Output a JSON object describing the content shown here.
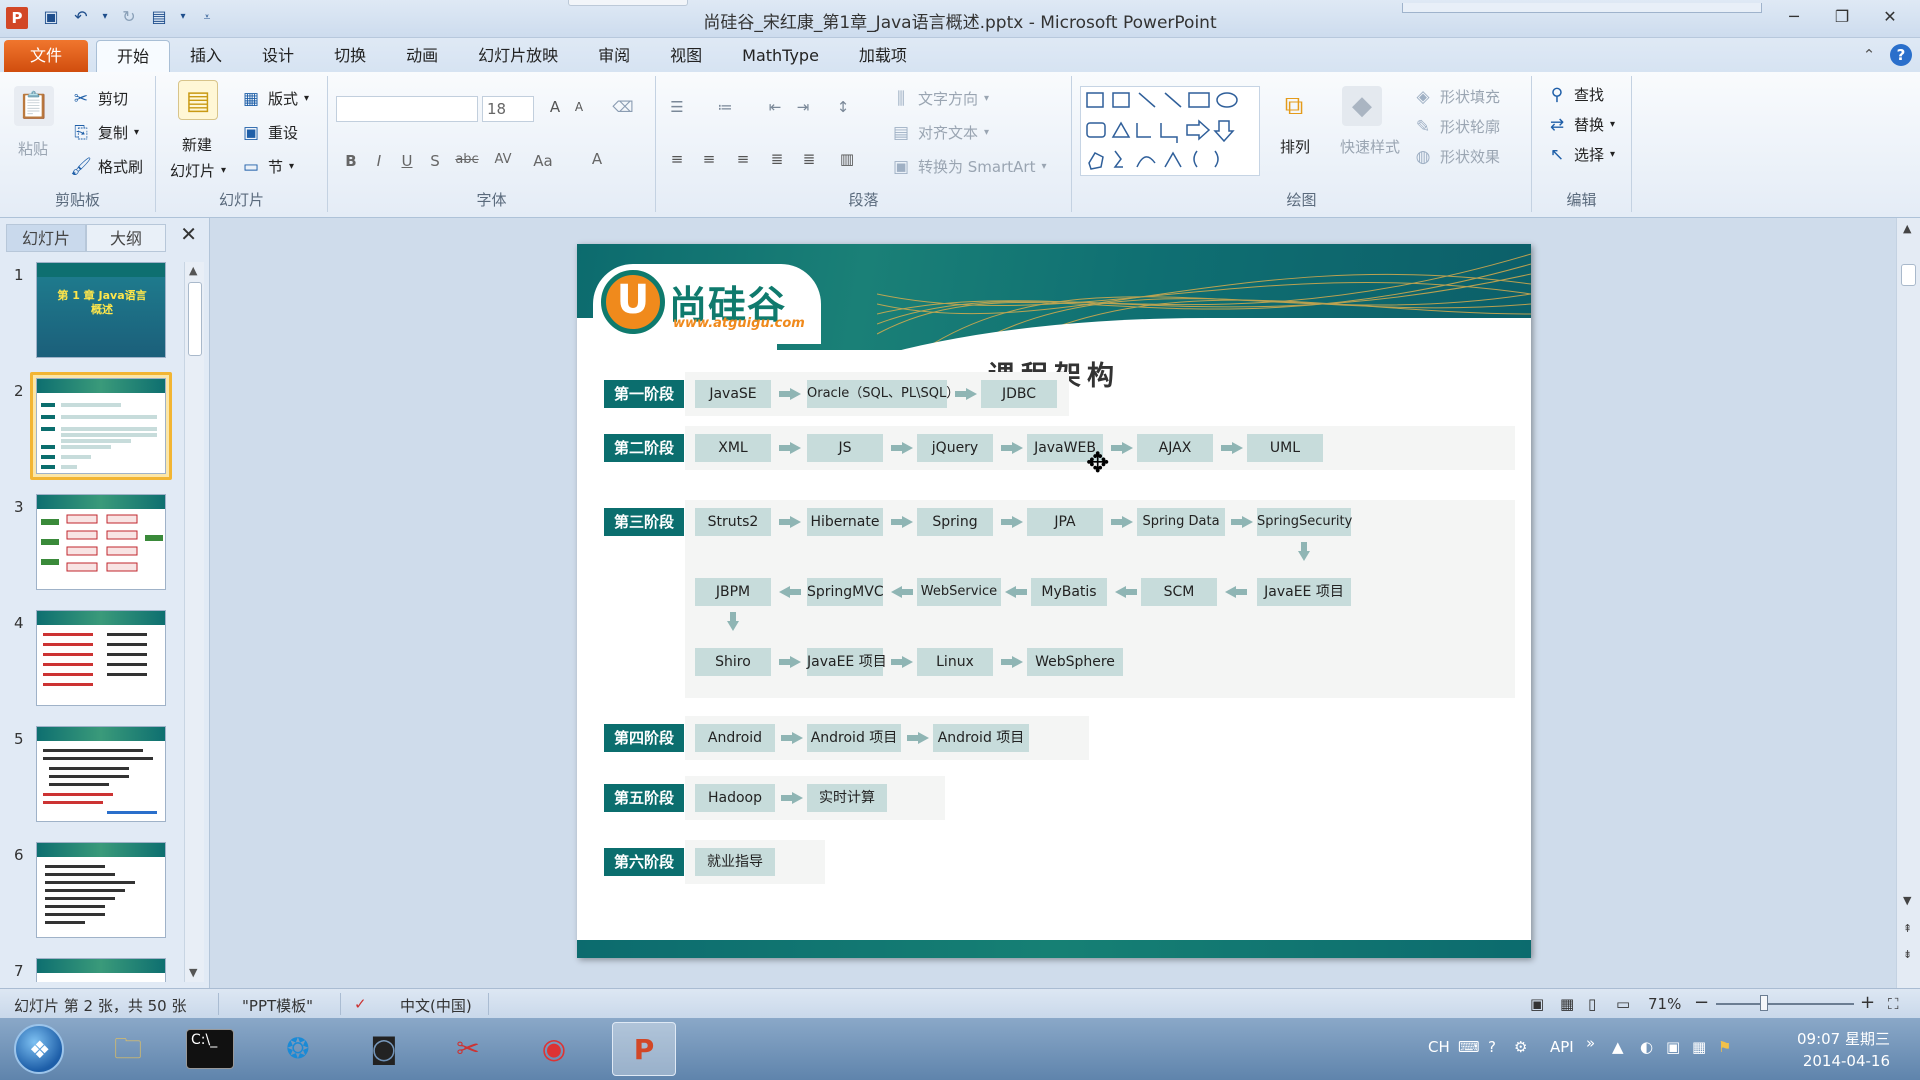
{
  "window": {
    "title": "尚硅谷_宋红康_第1章_Java语言概述.pptx - Microsoft PowerPoint",
    "app_icon_letter": "P",
    "controls": {
      "minimize": "─",
      "restore": "❐",
      "close": "✕"
    }
  },
  "quick_access": [
    "save-icon",
    "undo-icon",
    "redo-icon",
    "present-icon",
    "customize-icon"
  ],
  "tabs": [
    {
      "label": "文件"
    },
    {
      "label": "开始"
    },
    {
      "label": "插入"
    },
    {
      "label": "设计"
    },
    {
      "label": "切换"
    },
    {
      "label": "动画"
    },
    {
      "label": "幻灯片放映"
    },
    {
      "label": "审阅"
    },
    {
      "label": "视图"
    },
    {
      "label": "MathType"
    },
    {
      "label": "加载项"
    }
  ],
  "ribbon": {
    "clipboard": {
      "paste": "粘贴",
      "cut": "剪切",
      "copy": "复制",
      "format_painter": "格式刷",
      "label": "剪贴板"
    },
    "slides": {
      "new_slide_1": "新建",
      "new_slide_2": "幻灯片",
      "layout": "版式",
      "reset": "重设",
      "section": "节",
      "label": "幻灯片"
    },
    "font": {
      "size": "18",
      "label": "字体",
      "bold": "B",
      "italic": "I",
      "underline": "U",
      "shadow": "S",
      "strike": "abc",
      "spacing": "AV",
      "case": "Aa",
      "color": "A",
      "grow": "A",
      "shrink": "A"
    },
    "paragraph": {
      "text_direction": "文字方向",
      "align_text": "对齐文本",
      "smartart": "转换为 SmartArt",
      "label": "段落"
    },
    "drawing": {
      "arrange": "排列",
      "quick_styles": "快速样式",
      "shape_fill": "形状填充",
      "shape_outline": "形状轮廓",
      "shape_effects": "形状效果",
      "label": "绘图"
    },
    "editing": {
      "find": "查找",
      "replace": "替换",
      "select": "选择",
      "label": "编辑"
    }
  },
  "panel": {
    "tabs": [
      "幻灯片",
      "大纲"
    ],
    "close": "✕",
    "thumbnails": [
      {
        "num": "1",
        "title": "第 1 章 Java语言概述"
      },
      {
        "num": "2"
      },
      {
        "num": "3"
      },
      {
        "num": "4"
      },
      {
        "num": "5"
      },
      {
        "num": "6"
      },
      {
        "num": "7"
      }
    ],
    "selected": 2
  },
  "slide": {
    "logo_text": "尚硅谷",
    "logo_url": "www.atguigu.com",
    "logo_letter": "U",
    "title": "课程架构",
    "stages": [
      {
        "label": "第一阶段",
        "items": [
          "JavaSE",
          "Oracle（SQL、PL\\SQL）",
          "JDBC"
        ]
      },
      {
        "label": "第二阶段",
        "items": [
          "XML",
          "JS",
          "jQuery",
          "JavaWEB",
          "AJAX",
          "UML"
        ]
      },
      {
        "label": "第三阶段",
        "row1": [
          "Struts2",
          "Hibernate",
          "Spring",
          "JPA",
          "Spring Data",
          "SpringSecurity"
        ],
        "row2": [
          "JBPM",
          "SpringMVC",
          "WebService",
          "MyBatis",
          "SCM",
          "JavaEE 项目"
        ],
        "row3": [
          "Shiro",
          "JavaEE 项目",
          "Linux",
          "WebSphere"
        ]
      },
      {
        "label": "第四阶段",
        "items": [
          "Android",
          "Android 项目",
          "Android 项目"
        ]
      },
      {
        "label": "第五阶段",
        "items": [
          "Hadoop",
          "实时计算"
        ]
      },
      {
        "label": "第六阶段",
        "items": [
          "就业指导"
        ]
      }
    ]
  },
  "status": {
    "slide_info": "幻灯片 第 2 张，共 50 张",
    "theme": "\"PPT模板\"",
    "language": "中文(中国)",
    "zoom": "71%",
    "zoom_minus": "−",
    "zoom_plus": "+"
  },
  "taskbar": {
    "apps": [
      "explorer",
      "cmd",
      "qq",
      "camera",
      "snipping",
      "chrome",
      "powerpoint"
    ],
    "tray": {
      "ime": "CH",
      "api": "API"
    },
    "time": "09:07 星期三",
    "date": "2014-04-16"
  },
  "colors": {
    "accent_file_tab": "#e0601c",
    "slide_teal": "#0b6e6e",
    "tech_box": "#c7dcdb",
    "logo_orange": "#f08a1c"
  }
}
